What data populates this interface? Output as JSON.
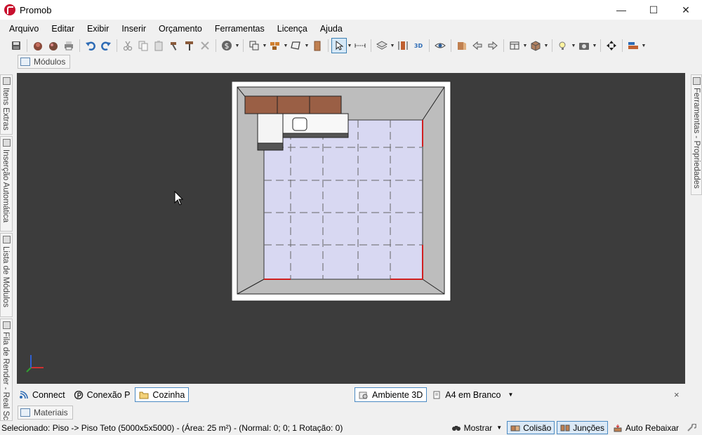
{
  "window": {
    "title": "Promob",
    "minimize": "—",
    "maximize": "☐",
    "close": "✕"
  },
  "menu": [
    "Arquivo",
    "Editar",
    "Exibir",
    "Inserir",
    "Orçamento",
    "Ferramentas",
    "Licença",
    "Ajuda"
  ],
  "top_tab": {
    "label": "Módulos"
  },
  "left_tabs": {
    "extras": "Itens Extras",
    "auto": "Inserção Automática",
    "modules": "Lista de Módulos",
    "render": "Fila de Render - Real Sc"
  },
  "right_tab": {
    "label": "Ferramentas - Propriedades"
  },
  "doc_tabs": {
    "connect": "Connect",
    "conexao": "Conexão P",
    "cozinha": "Cozinha",
    "ambiente": "Ambiente 3D",
    "a4": "A4 em Branco",
    "close": "×"
  },
  "bottom_tab": {
    "label": "Materiais"
  },
  "status": {
    "text": "Selecionado: Piso -> Piso Teto (5000x5x5000) - (Área: 25 m²) - (Normal: 0; 0; 1 Rotação: 0)",
    "mostrar": "Mostrar",
    "colisao": "Colisão",
    "juncoes": "Junções",
    "auto_rebaixar": "Auto Rebaixar"
  },
  "colors": {
    "viewport_bg": "#3c3c3c",
    "floor": "#d8d8f0",
    "wall": "#c0c0c0",
    "cabinet": "#9a5f45",
    "accent": "#4c8bc3"
  }
}
